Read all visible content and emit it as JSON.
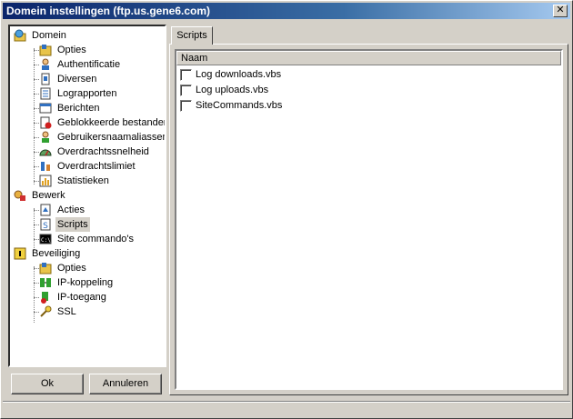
{
  "window": {
    "title": "Domein instellingen (ftp.us.gene6.com)"
  },
  "tree": {
    "root_domain": "Domein",
    "domain_items": [
      "Opties",
      "Authentificatie",
      "Diversen",
      "Lograpporten",
      "Berichten",
      "Geblokkeerde bestanden",
      "Gebruikersnaamaliassen",
      "Overdrachtssnelheid",
      "Overdrachtslimiet",
      "Statistieken"
    ],
    "root_bewerk": "Bewerk",
    "bewerk_items": [
      "Acties",
      "Scripts",
      "Site commando's"
    ],
    "root_security": "Beveiliging",
    "security_items": [
      "Opties",
      "IP-koppeling",
      "IP-toegang",
      "SSL"
    ],
    "selected": "Scripts"
  },
  "buttons": {
    "ok": "Ok",
    "cancel": "Annuleren"
  },
  "tabs": [
    {
      "label": "Scripts"
    }
  ],
  "list": {
    "header": "Naam",
    "rows": [
      {
        "label": "Log downloads.vbs",
        "checked": false
      },
      {
        "label": "Log uploads.vbs",
        "checked": false
      },
      {
        "label": "SiteCommands.vbs",
        "checked": false
      }
    ]
  },
  "colors": {
    "accent": "#0a246a",
    "face": "#d4d0c8"
  }
}
